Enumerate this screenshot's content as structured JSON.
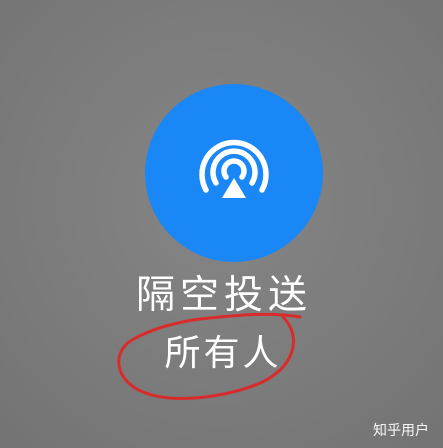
{
  "control": {
    "title": "隔空投送",
    "status": "所有人",
    "icon": "airdrop-icon",
    "accent_color": "#1a87f6",
    "background_color": "#7d7d7d"
  },
  "annotation": {
    "color": "#d92b2b",
    "shape": "hand-drawn-circle"
  },
  "watermark": {
    "text": "知乎用户"
  }
}
